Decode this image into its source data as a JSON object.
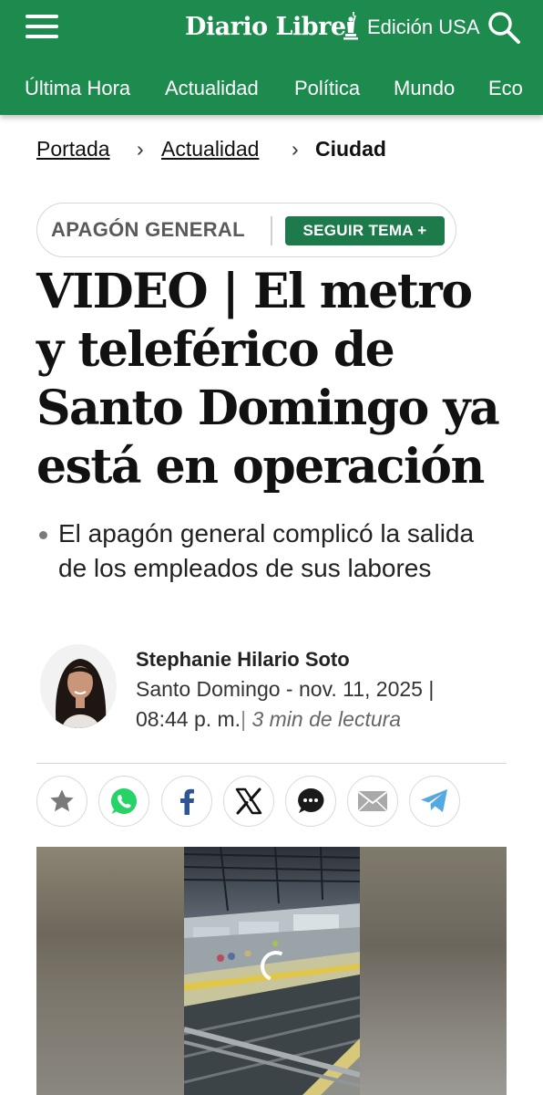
{
  "header": {
    "logo_text": "Diario Libre",
    "edition_label": "Edición USA",
    "brand_color": "#1d8a4e",
    "icons": [
      "hamburger-menu-icon",
      "liberty-statue-logo-icon",
      "search-icon"
    ]
  },
  "nav": {
    "items": [
      "Última Hora",
      "Actualidad",
      "Política",
      "Mundo",
      "Eco"
    ]
  },
  "breadcrumb": {
    "items": [
      "Portada",
      "Actualidad"
    ],
    "current": "Ciudad"
  },
  "topic": {
    "name": "APAGÓN GENERAL",
    "follow_label": "SEGUIR TEMA +"
  },
  "article": {
    "headline": "VIDEO | El metro y teleférico de Santo Domingo ya está en operación",
    "summary": "El apagón general complicó la salida de los empleados de sus labores",
    "author": "Stephanie Hilario Soto",
    "location_date": "Santo Domingo - nov. 11, 2025 |",
    "time": "08:44 p. m.",
    "read_time": "3 min de lectura"
  },
  "share": {
    "buttons": [
      "favorite-star",
      "whatsapp",
      "facebook",
      "x",
      "comments",
      "email",
      "telegram"
    ]
  },
  "video": {
    "state": "loading"
  }
}
